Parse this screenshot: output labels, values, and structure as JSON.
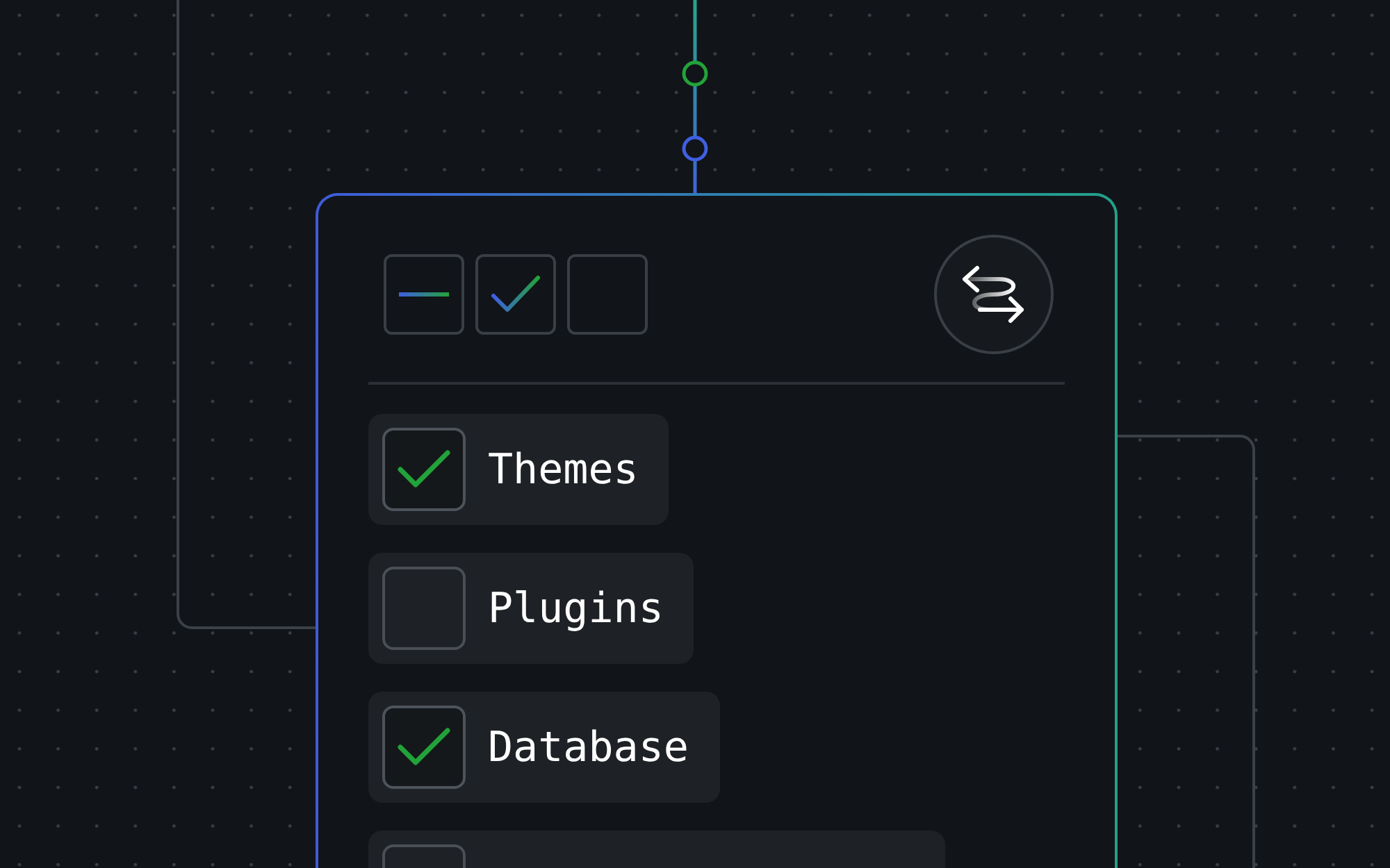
{
  "toolbar": {
    "checkboxes": [
      {
        "checked": false,
        "indeterminate": true
      },
      {
        "checked": true,
        "indeterminate": false
      },
      {
        "checked": false,
        "indeterminate": false
      }
    ]
  },
  "items": [
    {
      "label": "Themes",
      "checked": true
    },
    {
      "label": "Plugins",
      "checked": false
    },
    {
      "label": "Database",
      "checked": true
    },
    {
      "checked": false
    }
  ]
}
